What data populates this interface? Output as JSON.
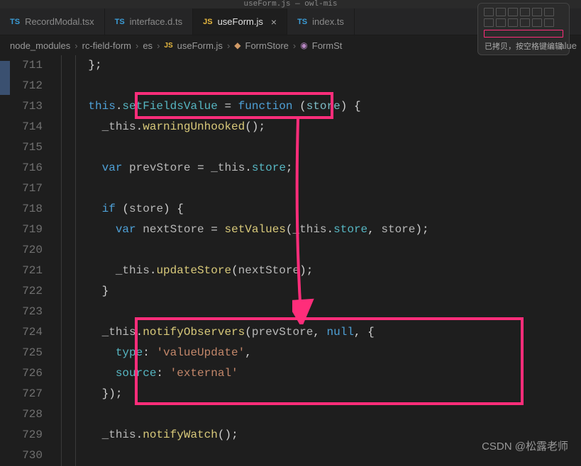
{
  "title": "useForm.js — owl-mis",
  "tabs": [
    {
      "icon": "TS",
      "label": "RecordModal.tsx",
      "active": false,
      "close": false
    },
    {
      "icon": "TS",
      "label": "interface.d.ts",
      "active": false,
      "close": false
    },
    {
      "icon": "JS",
      "label": "useForm.js",
      "active": true,
      "close": true
    },
    {
      "icon": "TS",
      "label": "index.ts",
      "active": false,
      "close": false
    }
  ],
  "breadcrumb": {
    "parts": [
      "node_modules",
      "rc-field-form",
      "es",
      "useForm.js",
      "FormStore",
      "FormSt"
    ],
    "trailing": "alue"
  },
  "tooltip": {
    "label": "已拷贝，按空格键编辑"
  },
  "lines": [
    {
      "n": 711,
      "html": "<span class='tok-punc'>};</span>"
    },
    {
      "n": 712,
      "html": ""
    },
    {
      "n": 713,
      "html": "<span class='tok-this'>this</span><span class='tok-punc'>.</span><span class='tok-prop'>setFieldsValue</span> <span class='tok-punc'>=</span> <span class='tok-fn'>function</span> <span class='tok-punc'>(</span><span class='tok-param'>store</span><span class='tok-punc'>)</span> <span class='tok-punc'>{</span>"
    },
    {
      "n": 714,
      "html": "  <span class='tok-plain'>_this</span><span class='tok-punc'>.</span><span class='tok-method'>warningUnhooked</span><span class='tok-punc'>();</span>"
    },
    {
      "n": 715,
      "html": ""
    },
    {
      "n": 716,
      "html": "  <span class='tok-kwvar'>var</span> <span class='tok-plain'>prevStore</span> <span class='tok-punc'>=</span> <span class='tok-plain'>_this</span><span class='tok-punc'>.</span><span class='tok-prop'>store</span><span class='tok-punc'>;</span>"
    },
    {
      "n": 717,
      "html": ""
    },
    {
      "n": 718,
      "html": "  <span class='tok-kw'>if</span> <span class='tok-punc'>(</span><span class='tok-plain'>store</span><span class='tok-punc'>)</span> <span class='tok-punc'>{</span>"
    },
    {
      "n": 719,
      "html": "    <span class='tok-kwvar'>var</span> <span class='tok-plain'>nextStore</span> <span class='tok-punc'>=</span> <span class='tok-method'>setValues</span><span class='tok-punc'>(</span><span class='tok-plain'>_this</span><span class='tok-punc'>.</span><span class='tok-prop'>store</span><span class='tok-punc'>,</span> <span class='tok-plain'>store</span><span class='tok-punc'>);</span>"
    },
    {
      "n": 720,
      "html": ""
    },
    {
      "n": 721,
      "html": "    <span class='tok-plain'>_this</span><span class='tok-punc'>.</span><span class='tok-method'>updateStore</span><span class='tok-punc'>(</span><span class='tok-plain'>nextStore</span><span class='tok-punc'>);</span>"
    },
    {
      "n": 722,
      "html": "  <span class='tok-punc'>}</span>"
    },
    {
      "n": 723,
      "html": ""
    },
    {
      "n": 724,
      "html": "  <span class='tok-plain'>_this</span><span class='tok-punc'>.</span><span class='tok-method'>notifyObservers</span><span class='tok-punc'>(</span><span class='tok-plain'>prevStore</span><span class='tok-punc'>,</span> <span class='tok-null'>null</span><span class='tok-punc'>,</span> <span class='tok-punc'>{</span>"
    },
    {
      "n": 725,
      "html": "    <span class='tok-prop'>type</span><span class='tok-punc'>:</span> <span class='tok-str'>'valueUpdate'</span><span class='tok-punc'>,</span>"
    },
    {
      "n": 726,
      "html": "    <span class='tok-prop'>source</span><span class='tok-punc'>:</span> <span class='tok-str'>'external'</span>"
    },
    {
      "n": 727,
      "html": "  <span class='tok-punc'>});</span>"
    },
    {
      "n": 728,
      "html": ""
    },
    {
      "n": 729,
      "html": "  <span class='tok-plain'>_this</span><span class='tok-punc'>.</span><span class='tok-method'>notifyWatch</span><span class='tok-punc'>();</span>"
    },
    {
      "n": 730,
      "html": ""
    }
  ],
  "watermark": "CSDN @松露老师",
  "highlight_color": "#ff2d7a"
}
